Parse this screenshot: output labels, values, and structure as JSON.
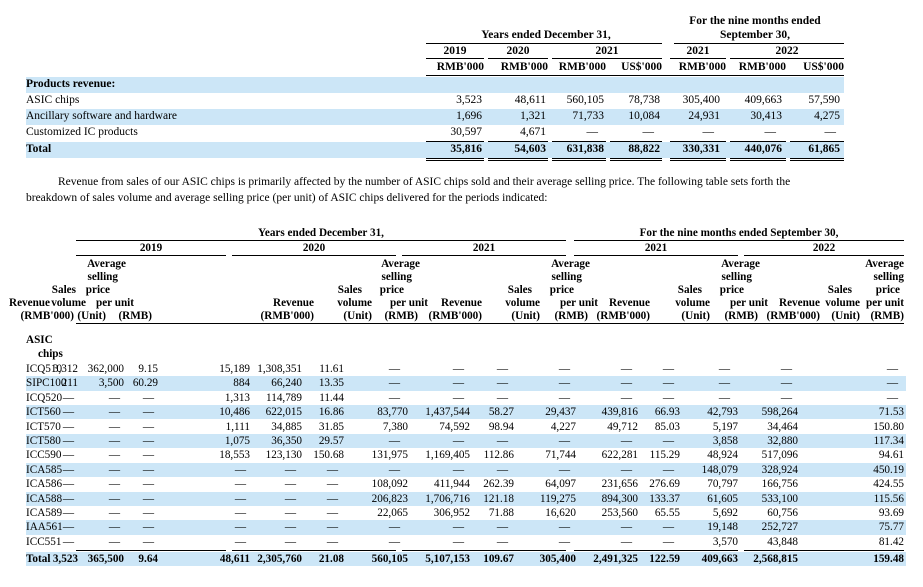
{
  "table1": {
    "group_years": "Years ended December 31,",
    "group_nine_1": "For the nine months ended",
    "group_nine_2": "September 30,",
    "years": [
      "2019",
      "2020",
      "2021",
      "2021",
      "2022"
    ],
    "units": [
      "RMB'000",
      "RMB'000",
      "RMB'000",
      "US$'000",
      "RMB'000",
      "RMB'000",
      "US$'000"
    ],
    "section_label": "Products revenue:",
    "rows": [
      {
        "label": "ASIC chips",
        "values": [
          "3,523",
          "48,611",
          "560,105",
          "78,738",
          "305,400",
          "409,663",
          "57,590"
        ]
      },
      {
        "label": "Ancillary software and hardware",
        "values": [
          "1,696",
          "1,321",
          "71,733",
          "10,084",
          "24,931",
          "30,413",
          "4,275"
        ]
      },
      {
        "label": "Customized IC products",
        "values": [
          "30,597",
          "4,671",
          "—",
          "—",
          "—",
          "—",
          "—"
        ]
      },
      {
        "label": "Total",
        "values": [
          "35,816",
          "54,603",
          "631,838",
          "88,822",
          "330,331",
          "440,076",
          "61,865"
        ]
      }
    ]
  },
  "paragraph": "Revenue from sales of our ASIC chips is primarily affected by the number of ASIC chips sold and their average selling price. The following table sets forth the breakdown of sales volume and average selling price (per unit) of ASIC chips delivered for the periods indicated:",
  "table2": {
    "group_years": "Years ended December 31,",
    "group_nine": "For the nine months ended September 30,",
    "years": [
      "2019",
      "2020",
      "2021",
      "2021",
      "2022"
    ],
    "col_head": {
      "revenue": "Revenue",
      "revenue_unit": "(RMB'000)",
      "sales": "Sales",
      "volume": "volume",
      "volume_unit": "(Unit)",
      "average": "Average",
      "selling": "selling",
      "price": "price",
      "per_unit": "per unit",
      "price_unit": "(RMB)"
    },
    "section_1": "ASIC",
    "section_2": "chips",
    "rows": [
      {
        "label": "ICQ510",
        "values": [
          "3,312",
          "362,000",
          "9.15",
          "15,189",
          "1,308,351",
          "11.61",
          "—",
          "—",
          "—",
          "—",
          "—",
          "—",
          "—",
          "—",
          "—"
        ]
      },
      {
        "label": "SIPC100",
        "values": [
          "211",
          "3,500",
          "60.29",
          "884",
          "66,240",
          "13.35",
          "—",
          "—",
          "—",
          "—",
          "—",
          "—",
          "—",
          "—",
          "—"
        ]
      },
      {
        "label": "ICQ520",
        "values": [
          "—",
          "—",
          "—",
          "1,313",
          "114,789",
          "11.44",
          "—",
          "—",
          "—",
          "—",
          "—",
          "—",
          "—",
          "—",
          "—"
        ]
      },
      {
        "label": "ICT560",
        "values": [
          "—",
          "—",
          "—",
          "10,486",
          "622,015",
          "16.86",
          "83,770",
          "1,437,544",
          "58.27",
          "29,437",
          "439,816",
          "66.93",
          "42,793",
          "598,264",
          "71.53"
        ]
      },
      {
        "label": "ICT570",
        "values": [
          "—",
          "—",
          "—",
          "1,111",
          "34,885",
          "31.85",
          "7,380",
          "74,592",
          "98.94",
          "4,227",
          "49,712",
          "85.03",
          "5,197",
          "34,464",
          "150.80"
        ]
      },
      {
        "label": "ICT580",
        "values": [
          "—",
          "—",
          "—",
          "1,075",
          "36,350",
          "29.57",
          "—",
          "—",
          "—",
          "—",
          "—",
          "—",
          "3,858",
          "32,880",
          "117.34"
        ]
      },
      {
        "label": "ICC590",
        "values": [
          "—",
          "—",
          "—",
          "18,553",
          "123,130",
          "150.68",
          "131,975",
          "1,169,405",
          "112.86",
          "71,744",
          "622,281",
          "115.29",
          "48,924",
          "517,096",
          "94.61"
        ]
      },
      {
        "label": "ICA585",
        "values": [
          "—",
          "—",
          "—",
          "—",
          "—",
          "—",
          "—",
          "—",
          "—",
          "—",
          "—",
          "—",
          "148,079",
          "328,924",
          "450.19"
        ]
      },
      {
        "label": "ICA586",
        "values": [
          "—",
          "—",
          "—",
          "—",
          "—",
          "—",
          "108,092",
          "411,944",
          "262.39",
          "64,097",
          "231,656",
          "276.69",
          "70,797",
          "166,756",
          "424.55"
        ]
      },
      {
        "label": "ICA588",
        "values": [
          "—",
          "—",
          "—",
          "—",
          "—",
          "—",
          "206,823",
          "1,706,716",
          "121.18",
          "119,275",
          "894,300",
          "133.37",
          "61,605",
          "533,100",
          "115.56"
        ]
      },
      {
        "label": "ICA589",
        "values": [
          "—",
          "—",
          "—",
          "—",
          "—",
          "—",
          "22,065",
          "306,952",
          "71.88",
          "16,620",
          "253,560",
          "65.55",
          "5,692",
          "60,756",
          "93.69"
        ]
      },
      {
        "label": "IAA561",
        "values": [
          "—",
          "—",
          "—",
          "—",
          "—",
          "—",
          "—",
          "—",
          "—",
          "—",
          "—",
          "—",
          "19,148",
          "252,727",
          "75.77"
        ]
      },
      {
        "label": "ICC551",
        "values": [
          "—",
          "—",
          "—",
          "—",
          "—",
          "—",
          "—",
          "—",
          "—",
          "—",
          "—",
          "—",
          "3,570",
          "43,848",
          "81.42"
        ]
      },
      {
        "label": "Total",
        "values": [
          "3,523",
          "365,500",
          "9.64",
          "48,611",
          "2,305,760",
          "21.08",
          "560,105",
          "5,107,153",
          "109.67",
          "305,400",
          "2,491,325",
          "122.59",
          "409,663",
          "2,568,815",
          "159.48"
        ]
      }
    ]
  }
}
